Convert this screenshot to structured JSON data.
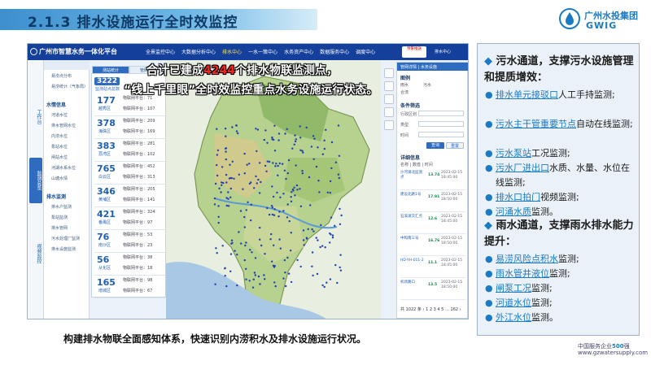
{
  "slide": {
    "title": "2.1.3 排水设施运行全时效监控",
    "logo_cn": "广州水投集团",
    "logo_en": "GWIG",
    "caption": "构建排水物联全面感知体系，快速识别内涝积水及排水设施运行状况。",
    "footer_line1_prefix": "中国服务企业",
    "footer_line1_num": "500",
    "footer_line1_suffix": "强",
    "footer_line2": "www.gzwatersupply.com",
    "colors": {
      "brand": "#1a7bc4",
      "title": "#0e3a66",
      "nav": "#14409c",
      "highlight": "#ff2020"
    }
  },
  "app": {
    "brand": "广州市智慧水务一体化平台",
    "menu": [
      "全景监控中心",
      "大数据分析中心",
      "排水中心",
      "一水一策中心",
      "水务资产中心",
      "数据服务中心",
      "调度中心"
    ],
    "active_menu_index": 2,
    "alert_badge": "预警推送",
    "user": "排水中心",
    "sidebar": [
      {
        "label": "工作台",
        "active": false
      },
      {
        "label": "监测总览",
        "active": true
      },
      {
        "label": "视频监控",
        "active": false
      }
    ],
    "tree": {
      "tab": "管网图",
      "groups": [
        {
          "header": "",
          "items": [
            "易涝点分布",
            "易涝统计（气象局）"
          ]
        },
        {
          "header": "水情信息",
          "items": [
            "河道水位",
            "排水管网水位",
            "内涝水位",
            "泵站水位",
            "闸站水位",
            "河湖水系水位",
            "山塘水情"
          ]
        },
        {
          "header": "排水监测",
          "items": [
            "排水户监测",
            "泵站监测",
            "排水管网",
            "污水处理厂监测",
            "排水设施监测"
          ]
        }
      ]
    },
    "stats": {
      "tabs": [
        "测站统计",
        "管网监测"
      ],
      "total": "3222",
      "total_sub": "监测站点总数",
      "rows": [
        {
          "num": "177",
          "district": "越秀区",
          "l1": "物联网平台：71",
          "l2": "物联网平台：107"
        },
        {
          "num": "378",
          "district": "海珠区",
          "l1": "物联网平台：209",
          "l2": "物联网平台：169"
        },
        {
          "num": "383",
          "district": "荔湾区",
          "l1": "物联网平台：281",
          "l2": "物联网平台：102"
        },
        {
          "num": "765",
          "district": "白云区",
          "l1": "物联网平台：452",
          "l2": "物联网平台：313"
        },
        {
          "num": "346",
          "district": "黄埔区",
          "l1": "物联网平台：205",
          "l2": "物联网平台：141"
        },
        {
          "num": "421",
          "district": "番禺区",
          "l1": "物联网平台：324",
          "l2": "物联网平台：97"
        },
        {
          "num": "76",
          "district": "南沙区",
          "l1": "物联网平台：53",
          "l2": "物联网平台：23"
        },
        {
          "num": "56",
          "district": "从化区",
          "l1": "物联网平台：38",
          "l2": "物联网平台：18"
        },
        {
          "num": "165",
          "district": "增城区",
          "l1": "物联网平台：98",
          "l2": "物联网平台：67"
        }
      ]
    },
    "overlay": {
      "line1_pre": "合计已建成",
      "line1_num": "4244",
      "line1_post": "个排水物联监测点，",
      "line2": "“线上千里眼”全时效监控重点水务设施运行状态。"
    },
    "panel": {
      "tabs": "管网详情 | 水务设施",
      "legend_header": "图例",
      "legend_items": [
        "雨水",
        "污水",
        "合流"
      ],
      "filter_header": "条件筛选",
      "filters": [
        "行政区划",
        "类型",
        "时间"
      ],
      "query_label": "查询",
      "reset_label": "重置",
      "detail_header": "详细信息",
      "cols": "名称 | 数值 | 时间",
      "rows": [
        {
          "name": "沙河涌北监测点",
          "value": "13.74",
          "time": "2023-02-15 18:45:00"
        },
        {
          "name": "建设北路1号",
          "value": "17.91",
          "time": "2023-02-15 18:50:00"
        },
        {
          "name": "石溪涌交汇点",
          "value": "12.6",
          "time": "2023-02-15 18:45:00"
        },
        {
          "name": "中和南三号",
          "value": "16.76",
          "time": "2023-02-15 18:50:00"
        },
        {
          "name": "HD-YH-011-2",
          "value": "11.1",
          "time": "2023-02-15 18:45:00"
        },
        {
          "name": "机场路口",
          "value": "13.5",
          "time": "2023-02-15 18:50:00"
        }
      ],
      "pager": "共 1022 条  ‹  1  2  3  4  5  …  162  ›"
    }
  },
  "right_panel": {
    "sewage_heading": "污水通道，支撑污水设施管理和提质增效：",
    "sewage_items": [
      {
        "u": "排水单元接驳口",
        "rest": "人工手持监测;"
      },
      {
        "u": "污水主干管重要节点",
        "rest": "自动在线监测;"
      },
      {
        "u": "污水泵站",
        "rest": "工况监测;"
      },
      {
        "u": "污水厂进出口",
        "rest": "水质、水量、水位在线监测;"
      },
      {
        "u": "排水口拍门",
        "rest": "视频监测;"
      },
      {
        "u": "河涌水质",
        "rest": "监测。"
      }
    ],
    "rain_heading": "雨水通道，支撑雨水排水能力提升：",
    "rain_items": [
      {
        "u": "易涝风险点积水",
        "rest": "监测;"
      },
      {
        "u": "雨水管井液位",
        "rest": "监测;"
      },
      {
        "u": "闸泵工况",
        "rest": "监测;"
      },
      {
        "u": "河道水位",
        "rest": "监测;"
      },
      {
        "u": "外江水位",
        "rest": "监测。"
      }
    ]
  }
}
